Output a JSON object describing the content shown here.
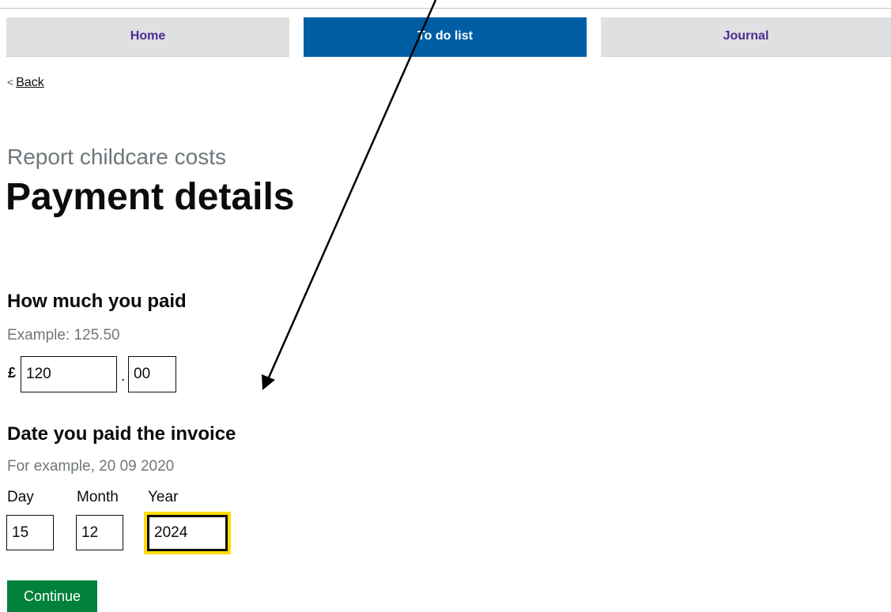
{
  "nav": {
    "tabs": [
      {
        "label": "Home",
        "active": false
      },
      {
        "label": "To do list",
        "active": true
      },
      {
        "label": "Journal",
        "active": false
      }
    ]
  },
  "back": {
    "chevron": "<",
    "label": "Back"
  },
  "page": {
    "caption": "Report childcare costs",
    "title": "Payment details"
  },
  "amount": {
    "heading": "How much you paid",
    "hint": "Example: 125.50",
    "currency_symbol": "£",
    "pounds_value": "120",
    "separator": ".",
    "pence_value": "00"
  },
  "date": {
    "heading": "Date you paid the invoice",
    "hint": "For example, 20 09 2020",
    "day_label": "Day",
    "month_label": "Month",
    "year_label": "Year",
    "day_value": "15",
    "month_value": "12",
    "year_value": "2024"
  },
  "actions": {
    "continue_label": "Continue"
  },
  "colors": {
    "nav_active": "#005ea5",
    "nav_inactive": "#dee0e2",
    "nav_link": "#4c2c92",
    "button_green": "#00823b",
    "focus_yellow": "#ffdd00",
    "secondary_text": "#6f777b"
  },
  "annotation": {
    "icon": "arrow-annotation-icon"
  }
}
